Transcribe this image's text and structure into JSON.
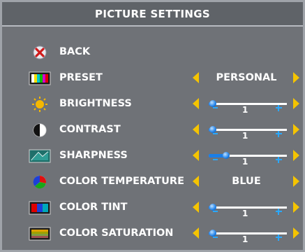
{
  "title": "PICTURE SETTINGS",
  "menu": [
    {
      "key": "back",
      "label": "BACK",
      "icon": "back-icon",
      "control": "none"
    },
    {
      "key": "preset",
      "label": "PRESET",
      "icon": "preset-icon",
      "control": "option",
      "value": "PERSONAL"
    },
    {
      "key": "brightness",
      "label": "BRIGHTNESS",
      "icon": "brightness-icon",
      "control": "slider",
      "value": "1",
      "level": 0.05
    },
    {
      "key": "contrast",
      "label": "CONTRAST",
      "icon": "contrast-icon",
      "control": "slider",
      "value": "1",
      "level": 0.05
    },
    {
      "key": "sharpness",
      "label": "SHARPNESS",
      "icon": "sharpness-icon",
      "control": "slider",
      "value": "1",
      "level": 0.22
    },
    {
      "key": "color_temperature",
      "label": "COLOR TEMPERATURE",
      "icon": "color-temperature-icon",
      "control": "option",
      "value": "BLUE"
    },
    {
      "key": "color_tint",
      "label": "COLOR TINT",
      "icon": "color-tint-icon",
      "control": "slider",
      "value": "1",
      "level": 0.05
    },
    {
      "key": "color_saturation",
      "label": "COLOR SATURATION",
      "icon": "color-saturation-icon",
      "control": "slider",
      "value": "1",
      "level": 0.05
    }
  ],
  "colors": {
    "background": "#6f7277",
    "title_bar": "#5f6368",
    "arrow": "#f5c400",
    "slider_accent": "#1a7ee8",
    "text": "#ffffff"
  }
}
